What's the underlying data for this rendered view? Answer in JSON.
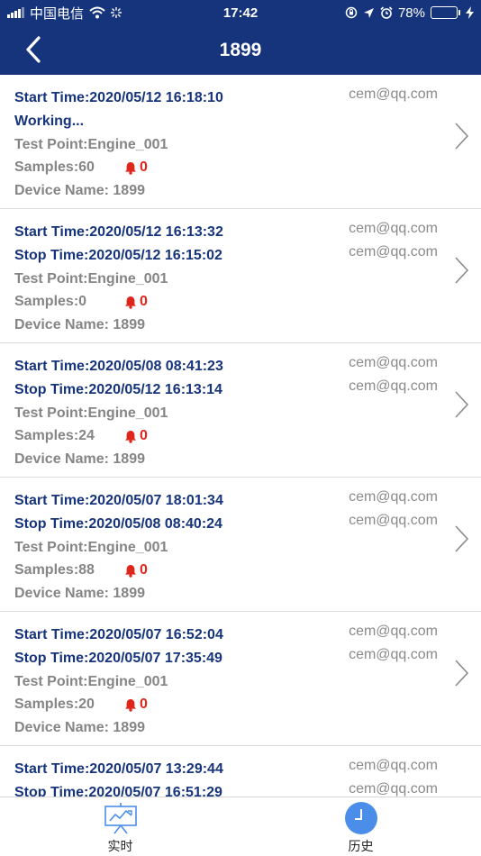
{
  "status_bar": {
    "carrier": "中国电信",
    "time": "17:42",
    "battery": "78%",
    "battery_level": 0.78,
    "icons": [
      "signal-icon",
      "wifi-icon",
      "loading-icon",
      "orientation-lock-icon",
      "location-icon",
      "alarm-clock-icon",
      "battery-icon",
      "charging-icon"
    ]
  },
  "nav": {
    "title": "1899",
    "back_icon": "back-chevron-icon"
  },
  "records": [
    {
      "start": "Start Time:2020/05/12 16:18:10",
      "second": "Working...",
      "test_point": "Test Point:Engine_001",
      "samples": "Samples:60",
      "alarms": "0",
      "device": "Device Name: 1899",
      "emails": [
        "cem@qq.com"
      ]
    },
    {
      "start": "Start Time:2020/05/12 16:13:32",
      "second": "Stop Time:2020/05/12 16:15:02",
      "test_point": "Test Point:Engine_001",
      "samples": "Samples:0",
      "alarms": "0",
      "device": "Device Name: 1899",
      "emails": [
        "cem@qq.com",
        "cem@qq.com"
      ]
    },
    {
      "start": "Start Time:2020/05/08 08:41:23",
      "second": "Stop Time:2020/05/12 16:13:14",
      "test_point": "Test Point:Engine_001",
      "samples": "Samples:24",
      "alarms": "0",
      "device": "Device Name: 1899",
      "emails": [
        "cem@qq.com",
        "cem@qq.com"
      ]
    },
    {
      "start": "Start Time:2020/05/07 18:01:34",
      "second": "Stop Time:2020/05/08 08:40:24",
      "test_point": "Test Point:Engine_001",
      "samples": "Samples:88",
      "alarms": "0",
      "device": "Device Name: 1899",
      "emails": [
        "cem@qq.com",
        "cem@qq.com"
      ]
    },
    {
      "start": "Start Time:2020/05/07 16:52:04",
      "second": "Stop Time:2020/05/07 17:35:49",
      "test_point": "Test Point:Engine_001",
      "samples": "Samples:20",
      "alarms": "0",
      "device": "Device Name: 1899",
      "emails": [
        "cem@qq.com",
        "cem@qq.com"
      ]
    },
    {
      "start": "Start Time:2020/05/07 13:29:44",
      "second": "Stop Time:2020/05/07 16:51:29",
      "emails": [
        "cem@qq.com",
        "cem@qq.com"
      ]
    }
  ],
  "tabs": [
    {
      "label": "实时",
      "icon": "realtime-chart-icon",
      "active": false
    },
    {
      "label": "历史",
      "icon": "history-clock-icon",
      "active": true
    }
  ],
  "colors": {
    "header": "#16347c",
    "primary_text": "#16347c",
    "secondary_text": "#858585",
    "alarm": "#e0261a",
    "tab_active": "#4a8eea",
    "battery_fill": "#4cd964"
  }
}
